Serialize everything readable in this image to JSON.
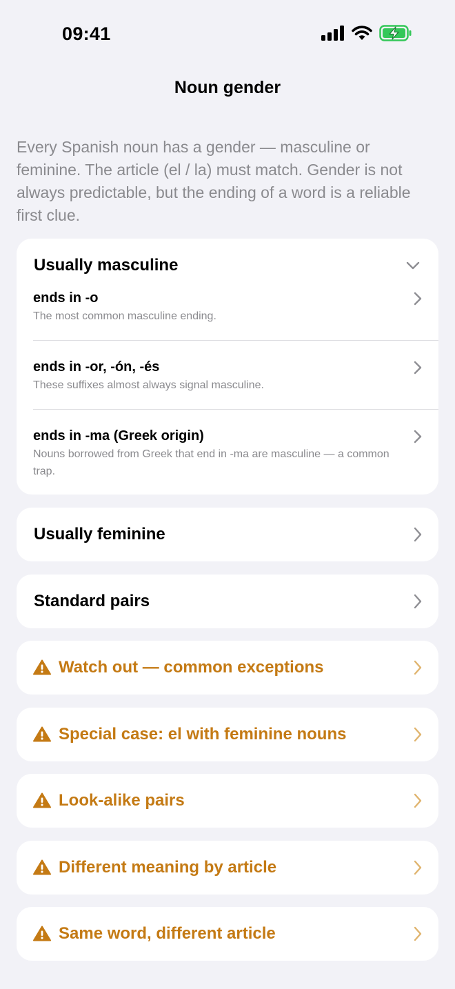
{
  "status_bar": {
    "time": "09:41",
    "icons": [
      "cellular-signal-icon",
      "wifi-icon",
      "battery-charging-icon"
    ]
  },
  "nav": {
    "title": "Noun gender"
  },
  "intro": "Every Spanish noun has a gender — masculine or feminine. The article (el / la) must match. Gender is not always predictable, but the ending of a word is a reliable first clue.",
  "sections": {
    "masculine": {
      "title": "Usually masculine",
      "expanded": true,
      "items": [
        {
          "title": "ends in -o",
          "desc": "The most common masculine ending."
        },
        {
          "title": "ends in -or, -ón, -és",
          "desc": "These suffixes almost always signal masculine."
        },
        {
          "title": "ends in -ma (Greek origin)",
          "desc": "Nouns borrowed from Greek that end in -ma are masculine — a common trap."
        }
      ]
    },
    "feminine": {
      "title": "Usually feminine"
    },
    "pairs": {
      "title": "Standard pairs"
    },
    "warnings": [
      {
        "title": "Watch out — common exceptions"
      },
      {
        "title": "Special case: el with feminine nouns"
      },
      {
        "title": "Look-alike pairs"
      },
      {
        "title": "Different meaning by article"
      },
      {
        "title": "Same word, different article"
      }
    ]
  },
  "colors": {
    "background": "#f2f2f7",
    "card": "#ffffff",
    "warning": "#c47a14",
    "secondary_text": "#8a8a8e",
    "chevron": "#8e8e93",
    "battery_fill": "#34c759"
  }
}
